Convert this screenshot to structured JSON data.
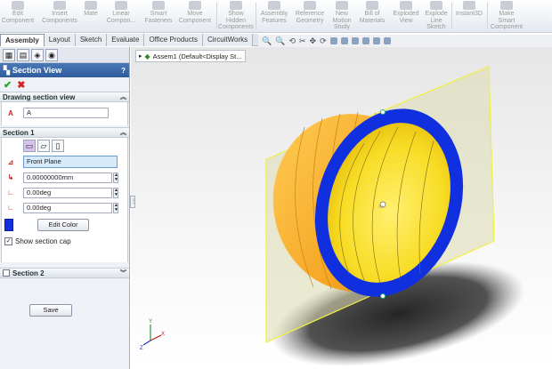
{
  "ribbon": {
    "buttons": [
      {
        "label": "Edit\nComponent"
      },
      {
        "label": "Insert\nComponents"
      },
      {
        "label": "Mate"
      },
      {
        "label": "Linear\nCompon..."
      },
      {
        "label": "Smart\nFasteners"
      },
      {
        "label": "Move\nComponent"
      },
      {
        "label": "Show\nHidden\nComponents"
      },
      {
        "label": "Assembly\nFeatures"
      },
      {
        "label": "Reference\nGeometry"
      },
      {
        "label": "New\nMotion\nStudy"
      },
      {
        "label": "Bill of\nMaterials"
      },
      {
        "label": "Exploded\nView"
      },
      {
        "label": "Explode\nLine\nSketch"
      },
      {
        "label": "Instant3D"
      },
      {
        "label": "Make\nSmart\nComponent"
      }
    ]
  },
  "tabs": [
    "Assembly",
    "Layout",
    "Sketch",
    "Evaluate",
    "Office Products",
    "CircuitWorks"
  ],
  "tree": {
    "label": "Assem1  (Default<Display St..."
  },
  "property_manager": {
    "title": "Section View",
    "help": "?",
    "drawing_section": {
      "title": "Drawing section view",
      "name_value": "A"
    },
    "section1": {
      "title": "Section 1",
      "plane_value": "Front Plane",
      "offset_value": "0.00000000mm",
      "angle_x_value": "0.00deg",
      "angle_y_value": "0.00deg",
      "edit_color_label": "Edit Color",
      "cap_label": "Show section cap",
      "cap_checked": true
    },
    "section2": {
      "title": "Section 2"
    },
    "save_label": "Save"
  },
  "colors": {
    "section_blue": "#1030e0",
    "shell_orange": "#f5a623",
    "interior_yellow": "#f8dc24",
    "plane_fill": "#dcdcb0",
    "plane_edge": "#f0f040",
    "pm_header": "#2f5c9c"
  },
  "icons": [
    "check-icon",
    "close-icon",
    "help-icon",
    "plane-icon",
    "color-swatch-icon",
    "triad-icon"
  ]
}
